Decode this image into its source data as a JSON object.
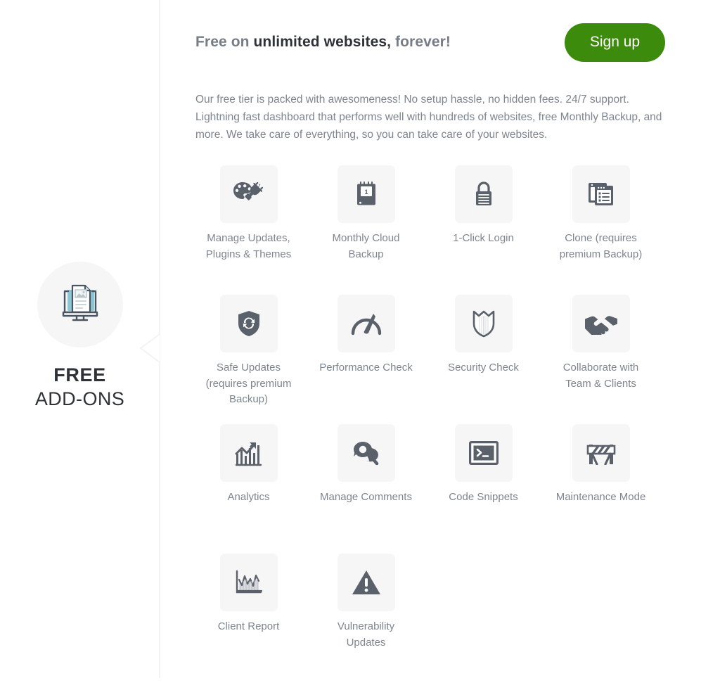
{
  "sidebar": {
    "icon": "monitor-documents-icon",
    "tier_name": "FREE",
    "tier_sub": "ADD-ONS"
  },
  "header": {
    "title_lead": "Free on ",
    "title_strong": "unlimited websites,",
    "title_tail": " forever!",
    "signup_label": "Sign up"
  },
  "intro": {
    "paragraph": "Our free tier is packed with awesomeness! No setup hassle, no hidden fees. 24/7 support. Lightning fast dashboard that performs well with hundreds of websites, free Monthly Backup, and more. We take care of everything, so you can take care of your websites."
  },
  "colors": {
    "accent_green": "#3d8b0c",
    "tile_bg": "#f6f6f6",
    "icon_gray": "#5b616b",
    "label_gray": "#7e858e",
    "heading_dark": "#2d3239",
    "divider": "#f3f3f5",
    "circle_bg": "#f6f6f7",
    "sidebar_icon_outline": "#4a5561",
    "sidebar_icon_accent": "#8ec5d4"
  },
  "features": [
    {
      "icon": "palette-plug-icon",
      "label": "Manage Updates, Plugins & Themes"
    },
    {
      "icon": "calendar-backup-icon",
      "label": "Monthly Cloud Backup"
    },
    {
      "icon": "padlock-icon",
      "label": "1-Click Login"
    },
    {
      "icon": "clone-windows-icon",
      "label": "Clone (requires premium Backup)"
    },
    {
      "icon": "shield-refresh-icon",
      "label": "Safe Updates (requires premium Backup)"
    },
    {
      "icon": "speedometer-icon",
      "label": "Performance Check"
    },
    {
      "icon": "shield-icon",
      "label": "Security Check"
    },
    {
      "icon": "handshake-icon",
      "label": "Collaborate with Team & Clients"
    },
    {
      "icon": "bar-chart-arrow-icon",
      "label": "Analytics"
    },
    {
      "icon": "speech-bubbles-icon",
      "label": "Manage Comments"
    },
    {
      "icon": "terminal-icon",
      "label": "Code Snippets"
    },
    {
      "icon": "road-barrier-icon",
      "label": "Maintenance Mode"
    },
    {
      "icon": "line-chart-icon",
      "label": "Client Report"
    },
    {
      "icon": "warning-triangle-icon",
      "label": "Vulnerability Updates"
    }
  ]
}
